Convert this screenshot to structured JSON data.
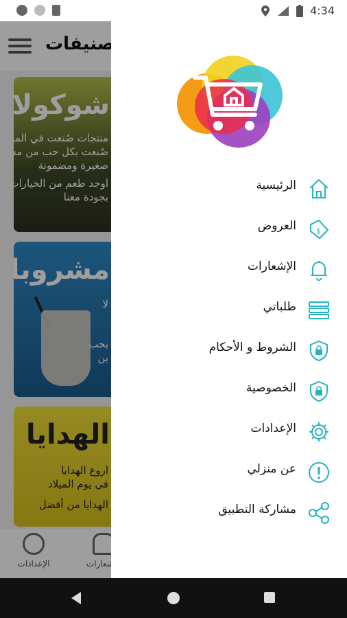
{
  "status_bar": {
    "time": "4:34"
  },
  "app": {
    "title": "تصنيفات",
    "cards": [
      {
        "title": "شوكولات",
        "lines": [
          "منتجات صُنعت في المنزل أو",
          "صُنعت بكل حب من مشاريع",
          "صغيرة ومضمونة",
          "اوجد طعم من الخيارات",
          "بجودة معنا"
        ]
      },
      {
        "title": "مشروبات",
        "lines": [
          "لا",
          "بحب",
          "ين"
        ]
      },
      {
        "title": "الهدايا",
        "lines": [
          "اروع الهدايا",
          "في يوم الميلاد",
          "الهدايا من أفضل"
        ]
      }
    ],
    "bottom_nav": [
      {
        "label": "الإعدادات",
        "icon": "gear-icon"
      },
      {
        "label": "الإشعارات",
        "icon": "bell-icon"
      }
    ]
  },
  "drawer": {
    "accent_color": "#26b3bf",
    "items": [
      {
        "label": "الرئيسية",
        "icon": "home-icon"
      },
      {
        "label": "العروض",
        "icon": "price-tag-icon"
      },
      {
        "label": "الإشعارات",
        "icon": "bell-icon"
      },
      {
        "label": "طلباتي",
        "icon": "list-icon"
      },
      {
        "label": "الشروط و الأحكام",
        "icon": "shield-lock-icon"
      },
      {
        "label": "الخصوصية",
        "icon": "shield-lock-icon"
      },
      {
        "label": "الإعدادات",
        "icon": "gear-icon"
      },
      {
        "label": "عن منزلي",
        "icon": "info-icon"
      },
      {
        "label": "مشاركة التطبيق",
        "icon": "share-icon"
      }
    ]
  }
}
